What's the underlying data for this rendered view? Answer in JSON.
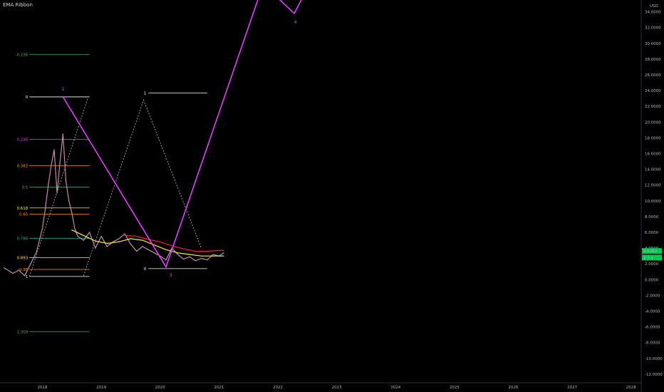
{
  "indicator": {
    "label": "EMA Ribbon"
  },
  "price_axis": {
    "currency": "USD"
  },
  "colors": {
    "background": "#000000",
    "wave": "#e040fb",
    "fib_white": "#ffffff",
    "fib_green": "#4caf50",
    "fib_magenta": "#e040fb",
    "fib_orange": "#ff9800",
    "fib_yellow": "#ffeb3b",
    "fib_teal": "#26a69a",
    "ema_yellow": "#ffeb3b",
    "ema_red": "#ff1744",
    "price_tag": "#00c853",
    "dashed": "#bdbdbd"
  },
  "chart_data": {
    "type": "line",
    "title": "",
    "x_ticks": [
      "2018",
      "2019",
      "2020",
      "2021",
      "2022",
      "2023",
      "2024",
      "2025",
      "2026",
      "2027",
      "2028"
    ],
    "y_ticks": [
      "34.0000",
      "32.0000",
      "30.0000",
      "28.0000",
      "26.0000",
      "24.0000",
      "22.0000",
      "20.0000",
      "18.0000",
      "16.0000",
      "14.0000",
      "12.0000",
      "10.0000",
      "8.0000",
      "6.0000",
      "4.0000",
      "2.0000",
      "0.0000",
      "-2.0000",
      "-4.0000",
      "-6.0000",
      "-8.0000",
      "-10.0000",
      "-12.0000"
    ],
    "ylim": [
      -13,
      35.5
    ],
    "xlim": [
      2017.28,
      2028.16
    ],
    "price_tags": [
      {
        "label": "3.6362",
        "value": 3.6362
      },
      {
        "label": "2.3.4",
        "value": 2.8
      }
    ],
    "fib_retracement": {
      "x_start": 2017.78,
      "x_end": 2018.8,
      "levels": [
        {
          "label": "-0.236",
          "value": 28.6,
          "color": "#4caf50"
        },
        {
          "label": "0",
          "value": 23.2,
          "color": "#ffffff"
        },
        {
          "label": "0.236",
          "value": 17.8,
          "color": "#e040fb"
        },
        {
          "label": "0.382",
          "value": 14.45,
          "color": "#ff9800"
        },
        {
          "label": "0.5",
          "value": 11.75,
          "color": "#4caf50"
        },
        {
          "label": "0.618",
          "value": 9.1,
          "color": "#ffeb3b"
        },
        {
          "label": "0.65",
          "value": 8.3,
          "color": "#ff9800"
        },
        {
          "label": "0.786",
          "value": 5.25,
          "color": "#26a69a"
        },
        {
          "label": "0.893",
          "value": 2.8,
          "color": "#ffeb3b"
        },
        {
          "label": "0.96",
          "value": 1.3,
          "color": "#ff9800"
        },
        {
          "label": "1",
          "value": 0.4,
          "color": "#ffffff"
        },
        {
          "label": "1.309",
          "value": -6.6,
          "color": "#4caf50"
        }
      ]
    },
    "small_fib": {
      "top": {
        "label": "1",
        "value": 23.7,
        "x_start": 2019.8,
        "x_end": 2020.8
      },
      "bottom": {
        "label": "0",
        "value": 1.4,
        "x_start": 2019.8,
        "x_end": 2020.8
      }
    },
    "wave_path": [
      {
        "x": 2018.35,
        "y": 23.2
      },
      {
        "x": 2020.1,
        "y": 1.6
      },
      {
        "x": 2021.75,
        "y": 37.5
      },
      {
        "x": 2022.28,
        "y": 33.8
      },
      {
        "x": 2022.5,
        "y": 37.0
      }
    ],
    "wave_labels": [
      {
        "label": "1",
        "x": 2018.35,
        "y": 24.0
      },
      {
        "x": 2020.18,
        "y": 0.4,
        "label": "3"
      },
      {
        "x": 2022.3,
        "y": 32.5,
        "label": "4"
      }
    ],
    "dashed_path": [
      {
        "x": 2017.78,
        "y": 0.4
      },
      {
        "x": 2018.77,
        "y": 23.0
      }
    ],
    "dashed_path2": [
      {
        "x": 2018.7,
        "y": 0.5
      },
      {
        "x": 2019.72,
        "y": 22.8
      },
      {
        "x": 2020.7,
        "y": 4.0
      }
    ],
    "series": [
      {
        "name": "",
        "color": "#c08db0",
        "x": [
          2017.35,
          2017.5,
          2017.6,
          2017.7,
          2017.8,
          2017.9,
          2018.0,
          2018.05,
          2018.1,
          2018.15,
          2018.2,
          2018.25,
          2018.3,
          2018.35,
          2018.4,
          2018.45,
          2018.5,
          2018.55,
          2018.6,
          2018.7,
          2018.8,
          2018.9,
          2019.0,
          2019.1,
          2019.2,
          2019.3,
          2019.4,
          2019.5,
          2019.6,
          2019.7,
          2019.8,
          2019.9,
          2020.0,
          2020.1,
          2020.2,
          2020.3,
          2020.4,
          2020.5,
          2020.6,
          2020.7,
          2020.8,
          2020.9,
          2021.0,
          2021.08
        ],
        "values": [
          1.5,
          0.8,
          1.2,
          0.5,
          2.0,
          3.5,
          6.5,
          9.0,
          12.0,
          14.5,
          16.5,
          11.0,
          15.0,
          18.5,
          12.5,
          10.0,
          8.5,
          6.5,
          5.5,
          5.0,
          6.0,
          4.0,
          5.5,
          4.2,
          4.8,
          5.2,
          5.8,
          4.5,
          3.6,
          4.2,
          3.8,
          3.4,
          3.0,
          2.5,
          4.0,
          3.2,
          2.6,
          2.9,
          2.4,
          2.7,
          2.5,
          3.2,
          3.0,
          3.4
        ]
      },
      {
        "name": "",
        "color": "#ffeb3b",
        "x": [
          2018.5,
          2018.7,
          2018.9,
          2019.1,
          2019.3,
          2019.5,
          2019.7,
          2019.9,
          2020.1,
          2020.3,
          2020.5,
          2020.7,
          2020.9,
          2021.08
        ],
        "values": [
          6.3,
          5.6,
          4.9,
          4.6,
          4.8,
          5.2,
          5.0,
          4.4,
          3.8,
          3.4,
          3.2,
          3.0,
          3.0,
          3.0
        ]
      },
      {
        "name": "",
        "color": "#ff1744",
        "x": [
          2019.4,
          2019.6,
          2019.8,
          2020.0,
          2020.2,
          2020.4,
          2020.6,
          2020.8,
          2021.0,
          2021.08
        ],
        "values": [
          5.6,
          5.5,
          5.1,
          4.8,
          4.3,
          3.9,
          3.6,
          3.6,
          3.7,
          3.7
        ]
      }
    ]
  }
}
